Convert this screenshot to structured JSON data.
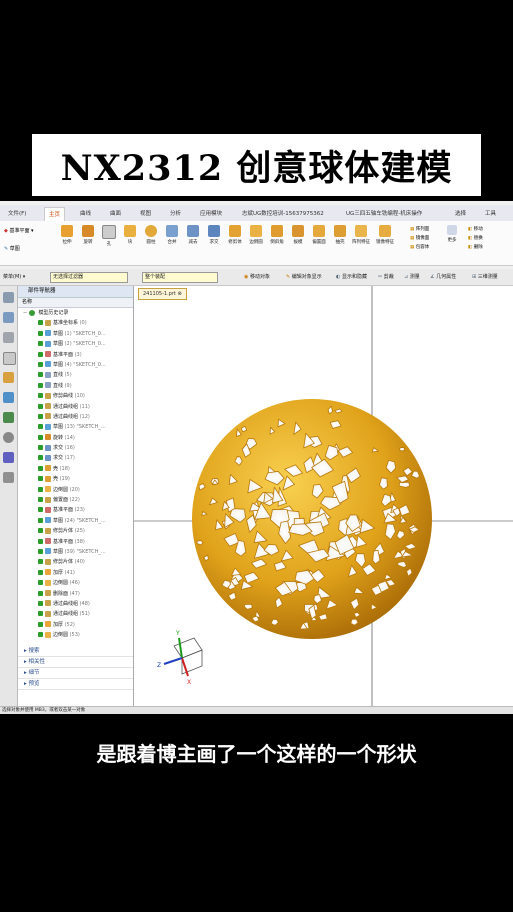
{
  "banner": {
    "title": "NX2312 创意球体建模"
  },
  "ribbon": {
    "tabs": [
      "文件(F)",
      "主页",
      "曲线",
      "曲面",
      "视图",
      "分析",
      "应用模块",
      "志斌UG数控培训-15637975362",
      "UG三四五轴车铣编程-机床操作",
      "选择",
      "工具"
    ],
    "active_tab": "主页",
    "left_items": {
      "datum_plane": "基准平面",
      "sketch": "草图",
      "construct": "构造"
    },
    "buttons": [
      "拉伸",
      "旋转",
      "孔",
      "块",
      "圆柱",
      "合并",
      "减去",
      "求交",
      "修剪体",
      "边倒圆",
      "倒斜角",
      "拔模",
      "偏置面",
      "抽壳",
      "阵列特征",
      "镜像特征"
    ],
    "right_items": [
      "阵列面",
      "镜像面",
      "包容体",
      "更多",
      "移动",
      "替换",
      "删除"
    ],
    "group_base": "基本",
    "group_sync": "同步"
  },
  "cmdbar": {
    "menu": "菜单(M) ▾",
    "filter": "无选择过滤器",
    "assembly": "整个装配",
    "items": [
      "移动对象",
      "编辑对象显示",
      "显示和隐藏",
      "剪裁",
      "测量",
      "几何属性",
      "三维测量"
    ]
  },
  "navigator": {
    "title": "部件导航器",
    "col_name": "名称",
    "root": "模型历史记录",
    "rows": [
      {
        "name": "基准坐标系",
        "num": "(0)"
      },
      {
        "name": "草图",
        "num": "(1) \"SKETCH_0..."
      },
      {
        "name": "草图",
        "num": "(2) \"SKETCH_0..."
      },
      {
        "name": "基准平面",
        "num": "(3)"
      },
      {
        "name": "草图",
        "num": "(4) \"SKETCH_0..."
      },
      {
        "name": "直线",
        "num": "(5)"
      },
      {
        "name": "直线",
        "num": "(9)"
      },
      {
        "name": "修剪曲线",
        "num": "(10)"
      },
      {
        "name": "通过曲线组",
        "num": "(11)"
      },
      {
        "name": "通过曲线组",
        "num": "(12)"
      },
      {
        "name": "草图",
        "num": "(13) \"SKETCH_..."
      },
      {
        "name": "旋转",
        "num": "(14)"
      },
      {
        "name": "求交",
        "num": "(16)"
      },
      {
        "name": "求交",
        "num": "(17)"
      },
      {
        "name": "壳",
        "num": "(18)"
      },
      {
        "name": "壳",
        "num": "(19)"
      },
      {
        "name": "边倒圆",
        "num": "(20)"
      },
      {
        "name": "偏置面",
        "num": "(22)"
      },
      {
        "name": "基准平面",
        "num": "(23)"
      },
      {
        "name": "草图",
        "num": "(24) \"SKETCH_..."
      },
      {
        "name": "修剪片体",
        "num": "(25)"
      },
      {
        "name": "基准平面",
        "num": "(38)"
      },
      {
        "name": "草图",
        "num": "(39) \"SKETCH_..."
      },
      {
        "name": "修剪片体",
        "num": "(40)"
      },
      {
        "name": "加厚",
        "num": "(41)"
      },
      {
        "name": "边倒圆",
        "num": "(46)"
      },
      {
        "name": "删除面",
        "num": "(47)"
      },
      {
        "name": "通过曲线组",
        "num": "(48)"
      },
      {
        "name": "通过曲线组",
        "num": "(51)"
      },
      {
        "name": "加厚",
        "num": "(52)"
      },
      {
        "name": "边倒圆",
        "num": "(53)"
      }
    ],
    "sections": [
      "搜索",
      "相关性",
      "细节",
      "预览"
    ]
  },
  "viewport": {
    "tab": "241105-1.prt ⊗"
  },
  "status": {
    "text": "选择对象并使用 MB3，或者双击某一对象"
  },
  "subtitle": {
    "text": "是跟着博主画了一个这样的一个形状"
  },
  "colors": {
    "ball": "#e0a21a",
    "ball_dark": "#a86a06",
    "ball_light": "#f8d050",
    "selection": "#fffbd0"
  }
}
